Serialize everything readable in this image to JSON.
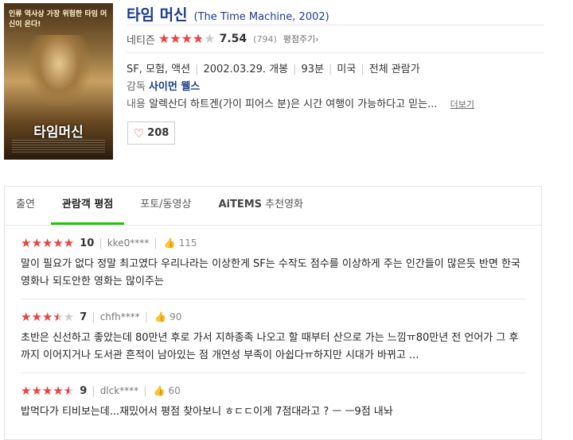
{
  "poster": {
    "tagline": "인류 역사상 가장 위험한 타임 머신이 온다!",
    "title": "타임머신"
  },
  "movie": {
    "title": "타임 머신",
    "original": "(The Time Machine, 2002)",
    "rating_label": "네티즌",
    "rating_score": "7.54",
    "rating_fraction": 0.754,
    "rating_count": "(794)",
    "rate_link": "평점주기›",
    "genre": "SF, 모험, 액션",
    "release": "2002.03.29. 개봉",
    "runtime": "93분",
    "country": "미국",
    "age": "전체 관람가",
    "director_label": "감독",
    "director": "사이먼 웰스",
    "desc_label": "내용",
    "desc": "알렉산더 하트겐(가이 피어스 분)은 시간 여행이 가능하다고 믿는...",
    "more": "더보기",
    "likes": "208"
  },
  "tabs": [
    {
      "label": "출연"
    },
    {
      "label": "관람객 평점"
    },
    {
      "label": "포토/동영상"
    },
    {
      "brand": "AiTEMS",
      "label": "추천영화"
    }
  ],
  "reviews": [
    {
      "score": "10",
      "fraction": 1.0,
      "user": "kke0****",
      "likes": "115",
      "text": "말이 필요가 없다 정말 최고였다 우리나라는 이상한게 SF는 수작도 점수를 이상하게 주는 인간들이 많은듯 반면 한국영화나 되도안한 영화는 많이주는"
    },
    {
      "score": "7",
      "fraction": 0.7,
      "user": "chfh****",
      "likes": "90",
      "text": "초반은 신선하고 좋았는데 80만년 후로 가서 지하종족 나오고 할 때부터 산으로 가는 느낌ㅠ80만년 전 언어가 그 후까지 이어지거나 도서관 흔적이 남아있는 점 개연성 부족이 아쉽다ㅠ하지만 시대가 바뀌고 ..."
    },
    {
      "score": "9",
      "fraction": 0.9,
      "user": "dlck****",
      "likes": "60",
      "text": "밥먹다가 티비보는데...재밌어서 평점 찾아보니 ㅎㄷㄷ이게 7점대라고 ? ㅡ ㅡ9점 내놔"
    }
  ],
  "colors": {
    "star": "#f04040",
    "accent": "#1ec800",
    "link": "#1a3c8c"
  }
}
